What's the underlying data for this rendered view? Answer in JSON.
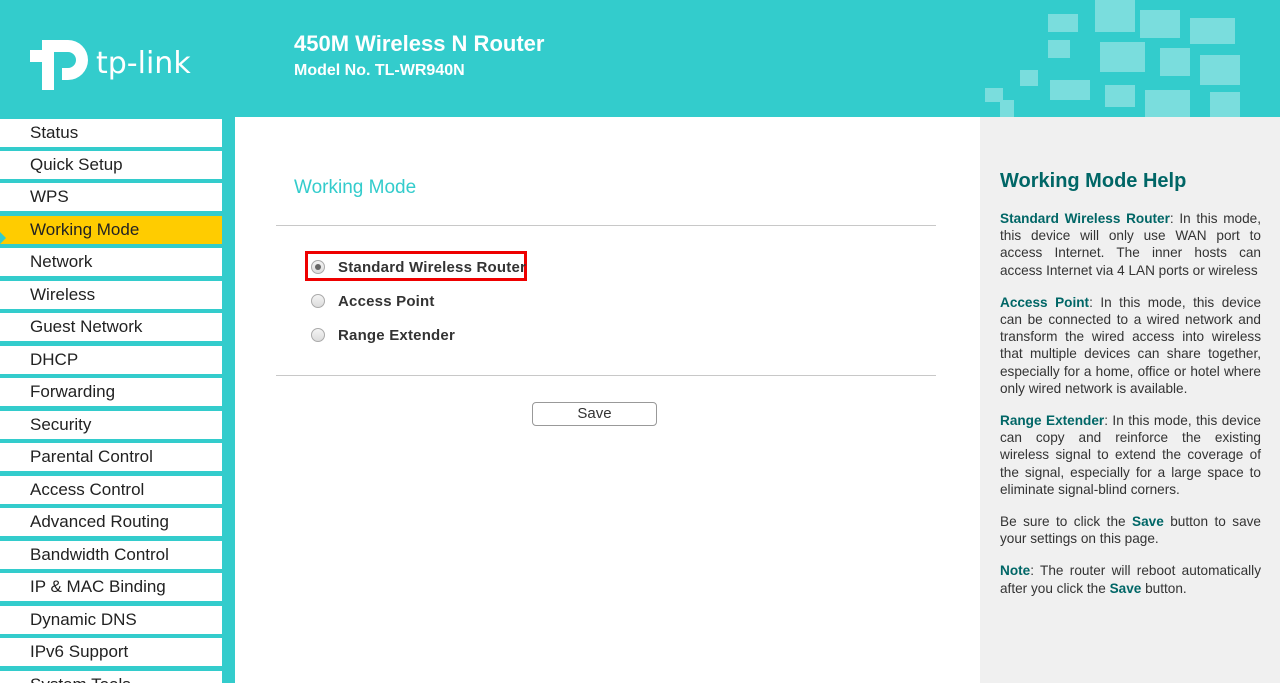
{
  "header": {
    "brand": "tp-link",
    "product_title": "450M Wireless N Router",
    "model_no": "Model No. TL-WR940N",
    "bg_color": "#33cccc"
  },
  "sidebar": {
    "items": [
      {
        "label": "Status"
      },
      {
        "label": "Quick Setup"
      },
      {
        "label": "WPS"
      },
      {
        "label": "Working Mode",
        "active": true
      },
      {
        "label": "Network"
      },
      {
        "label": "Wireless"
      },
      {
        "label": "Guest Network"
      },
      {
        "label": "DHCP"
      },
      {
        "label": "Forwarding"
      },
      {
        "label": "Security"
      },
      {
        "label": "Parental Control"
      },
      {
        "label": "Access Control"
      },
      {
        "label": "Advanced Routing"
      },
      {
        "label": "Bandwidth Control"
      },
      {
        "label": "IP & MAC Binding"
      },
      {
        "label": "Dynamic DNS"
      },
      {
        "label": "IPv6 Support"
      },
      {
        "label": "System Tools"
      }
    ],
    "active_color": "#ffcc00"
  },
  "main": {
    "title": "Working Mode",
    "options": [
      {
        "label": "Standard Wireless Router",
        "checked": true
      },
      {
        "label": "Access Point",
        "checked": false
      },
      {
        "label": "Range Extender",
        "checked": false
      }
    ],
    "save_label": "Save",
    "highlight_color": "#ee0000"
  },
  "help": {
    "title": "Working Mode Help",
    "p1_term": "Standard Wireless Router",
    "p1_text": ": In this mode, this device will only use WAN port to access Internet. The inner hosts can access Internet via 4 LAN ports or wireless",
    "p2_term": "Access Point",
    "p2_text": ": In this mode, this device can be connected to a wired network and transform the wired access into wireless that multiple devices can share together, especially for a home, office or hotel where only wired network is available.",
    "p3_term": "Range Extender",
    "p3_text": ": In this mode, this device can copy and reinforce the existing wireless signal to extend the coverage of the signal, especially for a large space to eliminate signal-blind corners.",
    "p4_pre": "Be sure to click the ",
    "p4_term": "Save",
    "p4_post": " button to save your settings on this page.",
    "p5_term": "Note",
    "p5_pre": ": The router will reboot automatically after you click the ",
    "p5_term2": "Save",
    "p5_post": " button."
  }
}
